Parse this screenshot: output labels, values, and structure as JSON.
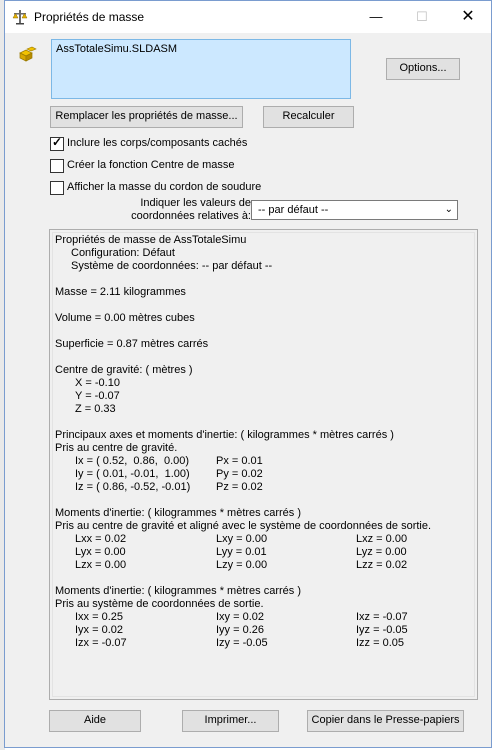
{
  "window": {
    "title": "Propriétés de masse",
    "controls": {
      "minimize": "—",
      "maximize": "☐",
      "close": "✕"
    },
    "icons": {
      "title": "scale-icon",
      "side": "assembly-icon"
    }
  },
  "selection": {
    "value": "AssTotaleSimu.SLDASM"
  },
  "buttons": {
    "options": "Options...",
    "replace": "Remplacer les propriétés de masse...",
    "recalc": "Recalculer",
    "help": "Aide",
    "print": "Imprimer...",
    "copy": "Copier dans le Presse-papiers"
  },
  "checkboxes": [
    {
      "label": "Inclure les corps/composants cachés",
      "checked": true
    },
    {
      "label": "Créer la fonction Centre de masse",
      "checked": false
    },
    {
      "label": "Afficher la masse du cordon de soudure",
      "checked": false
    }
  ],
  "coord": {
    "label_line1": "Indiquer les valeurs de",
    "label_line2": "coordonnées relatives à:",
    "selected": "-- par défaut --"
  },
  "results": {
    "header": "Propriétés de masse de AssTotaleSimu",
    "config": "Configuration: Défaut",
    "coord_system": "Système de coordonnées: -- par défaut --",
    "mass": "Masse = 2.11 kilogrammes",
    "volume": "Volume = 0.00 mètres cubes",
    "area": "Superficie = 0.87 mètres carrés",
    "cog_title": "Centre de gravité: ( mètres )",
    "cog": [
      "X = -0.10",
      "Y = -0.07",
      "Z = 0.33"
    ],
    "principal_title": "Principaux axes et moments d'inertie: ( kilogrammes * mètres carrés )",
    "principal_sub": "Pris au centre de gravité.",
    "principal_axes": [
      "Ix = ( 0.52,  0.86,  0.00)",
      "Iy = ( 0.01, -0.01,  1.00)",
      "Iz = ( 0.86, -0.52, -0.01)"
    ],
    "principal_moments": [
      "Px = 0.01",
      "Py = 0.02",
      "Pz = 0.02"
    ],
    "inertia_cog_title": "Moments d'inertie: ( kilogrammes * mètres carrés )",
    "inertia_cog_sub": "Pris au centre de gravité et aligné avec le système de coordonnées de sortie.",
    "inertia_cog": [
      [
        "Lxx = 0.02",
        "Lxy = 0.00",
        "Lxz = 0.00"
      ],
      [
        "Lyx = 0.00",
        "Lyy = 0.01",
        "Lyz = 0.00"
      ],
      [
        "Lzx = 0.00",
        "Lzy = 0.00",
        "Lzz = 0.02"
      ]
    ],
    "inertia_out_title": "Moments d'inertie: ( kilogrammes * mètres carrés )",
    "inertia_out_sub": "Pris au système de coordonnées de sortie.",
    "inertia_out": [
      [
        "Ixx = 0.25",
        "Ixy = 0.02",
        "Ixz = -0.07"
      ],
      [
        "Iyx = 0.02",
        "Iyy = 0.26",
        "Iyz = -0.05"
      ],
      [
        "Izx = -0.07",
        "Izy = -0.05",
        "Izz = 0.05"
      ]
    ]
  }
}
